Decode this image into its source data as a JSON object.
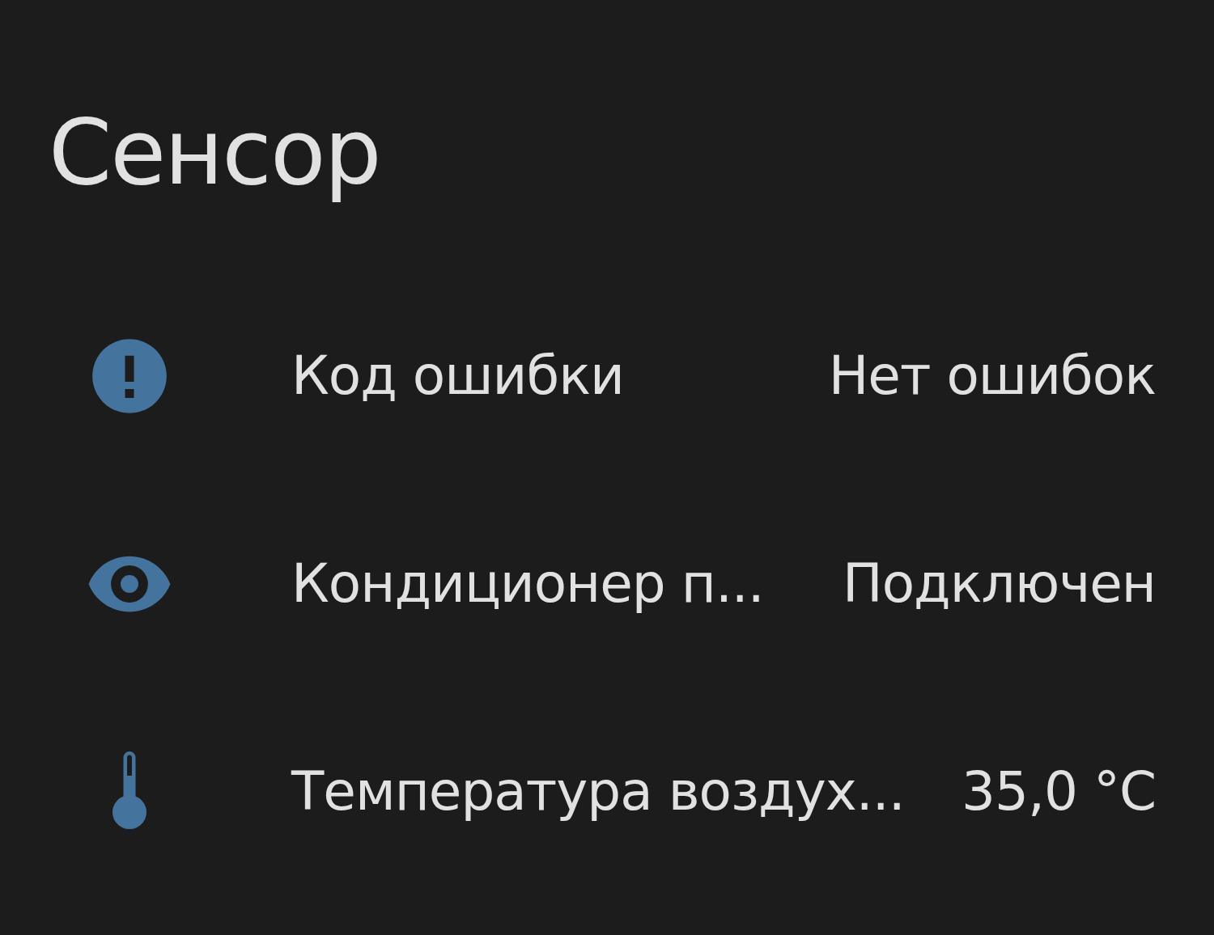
{
  "card": {
    "title": "Сенсор",
    "entities": [
      {
        "name": "Код ошибки",
        "state": "Нет ошибок"
      },
      {
        "name": "Кондиционер п...",
        "state": "Подключен"
      },
      {
        "name": "Температура воздух...",
        "state": "35,0 °C"
      }
    ]
  }
}
